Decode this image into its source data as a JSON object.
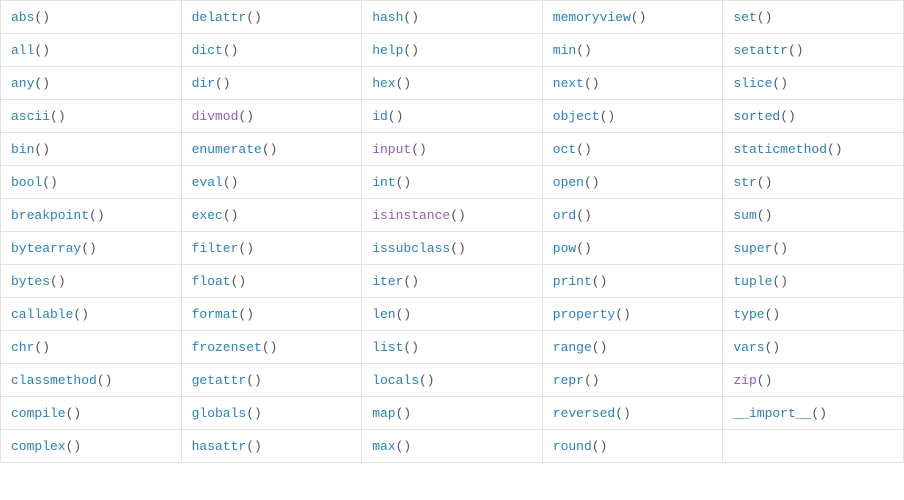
{
  "functions": {
    "rows": [
      [
        {
          "name": "abs",
          "visited": false
        },
        {
          "name": "delattr",
          "visited": false
        },
        {
          "name": "hash",
          "visited": false
        },
        {
          "name": "memoryview",
          "visited": false
        },
        {
          "name": "set",
          "visited": false
        }
      ],
      [
        {
          "name": "all",
          "visited": false
        },
        {
          "name": "dict",
          "visited": false
        },
        {
          "name": "help",
          "visited": false
        },
        {
          "name": "min",
          "visited": false
        },
        {
          "name": "setattr",
          "visited": false
        }
      ],
      [
        {
          "name": "any",
          "visited": false
        },
        {
          "name": "dir",
          "visited": false
        },
        {
          "name": "hex",
          "visited": false
        },
        {
          "name": "next",
          "visited": false
        },
        {
          "name": "slice",
          "visited": false
        }
      ],
      [
        {
          "name": "ascii",
          "visited": false
        },
        {
          "name": "divmod",
          "visited": true
        },
        {
          "name": "id",
          "visited": false
        },
        {
          "name": "object",
          "visited": false
        },
        {
          "name": "sorted",
          "visited": false
        }
      ],
      [
        {
          "name": "bin",
          "visited": false
        },
        {
          "name": "enumerate",
          "visited": false
        },
        {
          "name": "input",
          "visited": true
        },
        {
          "name": "oct",
          "visited": false
        },
        {
          "name": "staticmethod",
          "visited": false
        }
      ],
      [
        {
          "name": "bool",
          "visited": false
        },
        {
          "name": "eval",
          "visited": false
        },
        {
          "name": "int",
          "visited": false
        },
        {
          "name": "open",
          "visited": false
        },
        {
          "name": "str",
          "visited": false
        }
      ],
      [
        {
          "name": "breakpoint",
          "visited": false
        },
        {
          "name": "exec",
          "visited": false
        },
        {
          "name": "isinstance",
          "visited": true
        },
        {
          "name": "ord",
          "visited": false
        },
        {
          "name": "sum",
          "visited": false
        }
      ],
      [
        {
          "name": "bytearray",
          "visited": false
        },
        {
          "name": "filter",
          "visited": false
        },
        {
          "name": "issubclass",
          "visited": false
        },
        {
          "name": "pow",
          "visited": false
        },
        {
          "name": "super",
          "visited": false
        }
      ],
      [
        {
          "name": "bytes",
          "visited": false
        },
        {
          "name": "float",
          "visited": false
        },
        {
          "name": "iter",
          "visited": false
        },
        {
          "name": "print",
          "visited": false
        },
        {
          "name": "tuple",
          "visited": false
        }
      ],
      [
        {
          "name": "callable",
          "visited": false
        },
        {
          "name": "format",
          "visited": false
        },
        {
          "name": "len",
          "visited": false
        },
        {
          "name": "property",
          "visited": false
        },
        {
          "name": "type",
          "visited": false
        }
      ],
      [
        {
          "name": "chr",
          "visited": false
        },
        {
          "name": "frozenset",
          "visited": false
        },
        {
          "name": "list",
          "visited": false
        },
        {
          "name": "range",
          "visited": false
        },
        {
          "name": "vars",
          "visited": false
        }
      ],
      [
        {
          "name": "classmethod",
          "visited": false
        },
        {
          "name": "getattr",
          "visited": false
        },
        {
          "name": "locals",
          "visited": false
        },
        {
          "name": "repr",
          "visited": false
        },
        {
          "name": "zip",
          "visited": true
        }
      ],
      [
        {
          "name": "compile",
          "visited": false
        },
        {
          "name": "globals",
          "visited": false
        },
        {
          "name": "map",
          "visited": false
        },
        {
          "name": "reversed",
          "visited": false
        },
        {
          "name": "__import__",
          "visited": false
        }
      ],
      [
        {
          "name": "complex",
          "visited": false
        },
        {
          "name": "hasattr",
          "visited": false
        },
        {
          "name": "max",
          "visited": false
        },
        {
          "name": "round",
          "visited": false
        },
        {
          "name": "",
          "visited": false
        }
      ]
    ]
  },
  "parens": "()"
}
